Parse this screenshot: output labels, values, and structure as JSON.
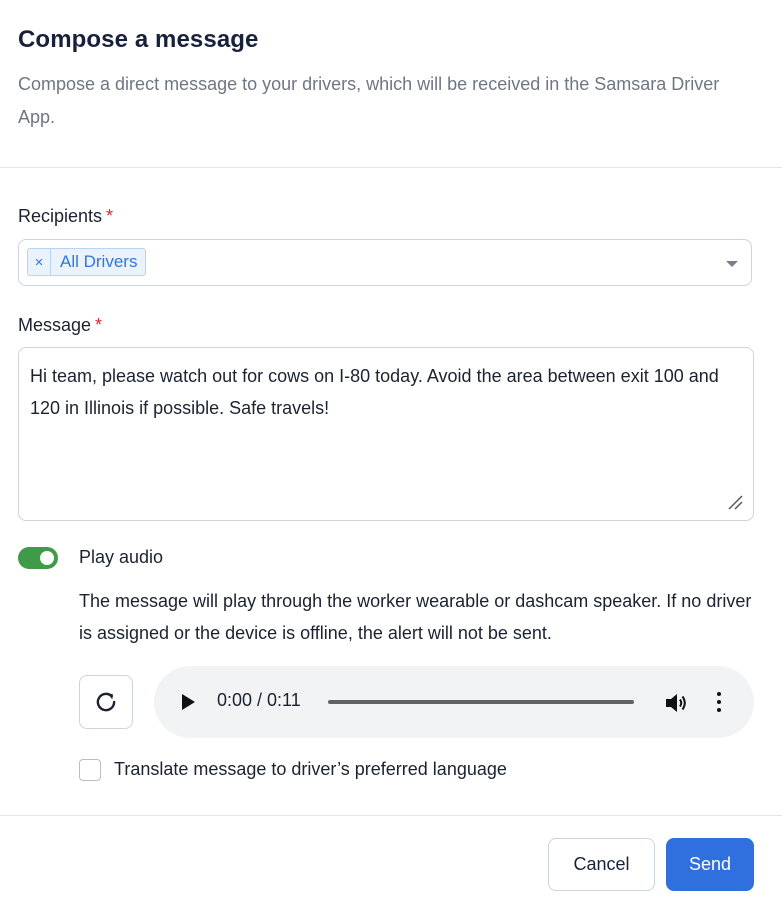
{
  "header": {
    "title": "Compose a message",
    "subtitle": "Compose a direct message to your drivers, which will be received in the Samsara Driver App."
  },
  "recipients": {
    "label": "Recipients",
    "required_mark": "*",
    "chip_remove": "×",
    "chips": [
      "All Drivers"
    ]
  },
  "message": {
    "label": "Message",
    "required_mark": "*",
    "value": "Hi team, please watch out for cows on I-80 today. Avoid the area between exit 100 and 120 in Illinois if possible. Safe travels!"
  },
  "audio": {
    "toggle_label": "Play audio",
    "toggle_on": true,
    "description": "The message will play through the worker wearable or dashcam speaker. If no driver is assigned or the device is offline, the alert will not be sent.",
    "player_time": "0:00 / 0:11"
  },
  "translate": {
    "label": "Translate message to driver’s preferred language",
    "checked": false
  },
  "footer": {
    "cancel_label": "Cancel",
    "send_label": "Send"
  },
  "colors": {
    "accent": "#2f6fde",
    "toggle_on": "#3f9a4a",
    "required": "#d12d2d",
    "chip": "#2f78d6"
  }
}
